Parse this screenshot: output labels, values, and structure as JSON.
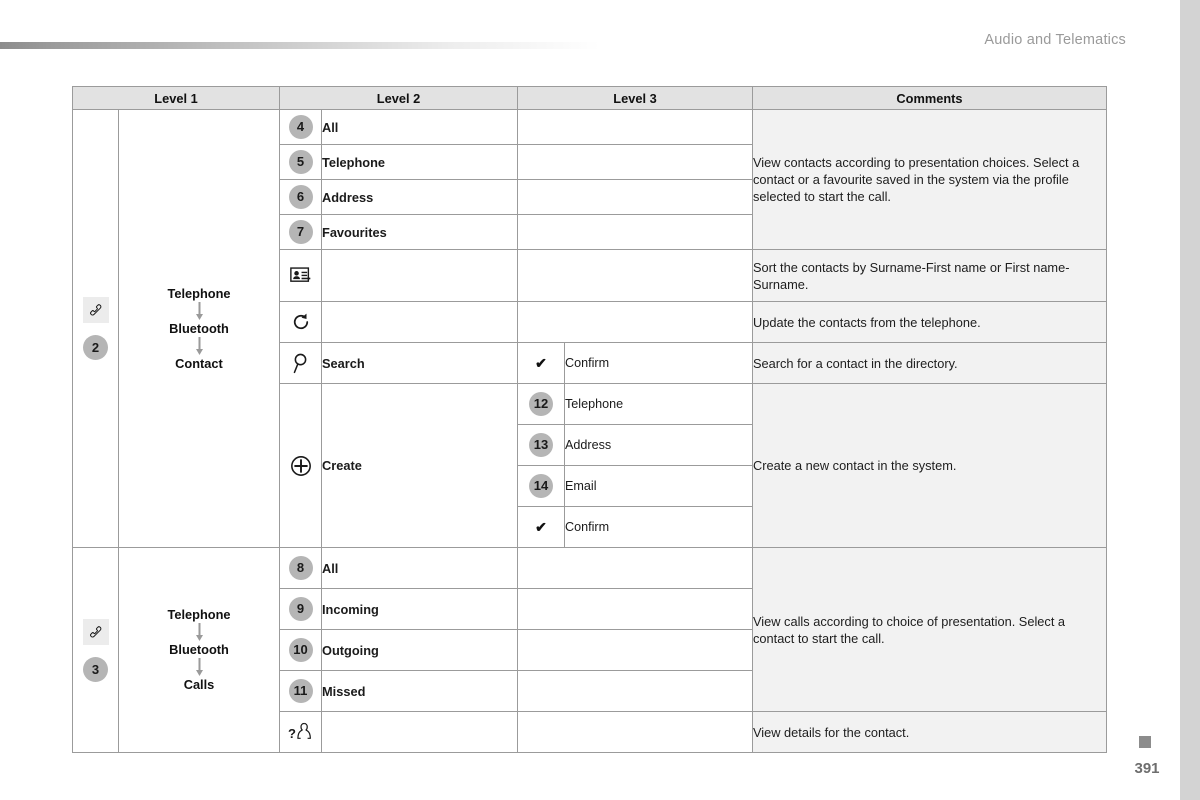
{
  "header": {
    "title": "Audio and Telematics"
  },
  "footer": {
    "page_number": "391",
    "marker_icon": "square-marker-icon"
  },
  "table": {
    "columns": [
      "Level 1",
      "Level 2",
      "Level 3",
      "Comments"
    ],
    "sections": [
      {
        "id_badge": "2",
        "id_icon": "telephone-handset-icon",
        "nav_path": [
          "Telephone",
          "Bluetooth",
          "Contact"
        ],
        "rows": [
          {
            "badge": "4",
            "level2": "All",
            "level3": "",
            "level3_icon": ""
          },
          {
            "badge": "5",
            "level2": "Telephone",
            "level3": "",
            "level3_icon": ""
          },
          {
            "badge": "6",
            "level2": "Address",
            "level3": "",
            "level3_icon": ""
          },
          {
            "badge": "7",
            "level2": "Favourites",
            "level3": "",
            "level3_icon": ""
          },
          {
            "icon": "contact-card-sort-icon",
            "level2": "",
            "level3": "",
            "level3_icon": ""
          },
          {
            "icon": "refresh-circular-arrow-icon",
            "level2": "",
            "level3": "",
            "level3_icon": ""
          },
          {
            "icon": "magnifier-search-icon",
            "level2": "Search",
            "level3": "Confirm",
            "level3_icon": "checkmark-icon"
          },
          {
            "icon": "plus-circle-create-icon",
            "level2": "Create",
            "level3": "Telephone",
            "badge3": "12"
          },
          {
            "level3": "Address",
            "badge3": "13"
          },
          {
            "level3": "Email",
            "badge3": "14"
          },
          {
            "level3": "Confirm",
            "level3_icon": "checkmark-icon"
          }
        ],
        "comments": [
          "View contacts according to presentation choices. Select a contact or a favourite saved in the system via the profile selected to start the call.",
          "Sort the contacts by Surname-First name or First name-Surname.",
          "Update the contacts from the telephone.",
          "Search for a contact in the directory.",
          "Create a new contact in the system."
        ]
      },
      {
        "id_badge": "3",
        "id_icon": "telephone-handset-icon",
        "nav_path": [
          "Telephone",
          "Bluetooth",
          "Calls"
        ],
        "rows": [
          {
            "badge": "8",
            "level2": "All"
          },
          {
            "badge": "9",
            "level2": "Incoming"
          },
          {
            "badge": "10",
            "level2": "Outgoing"
          },
          {
            "badge": "11",
            "level2": "Missed"
          },
          {
            "icon": "person-question-details-icon",
            "level2": ""
          }
        ],
        "comments": [
          "View calls according to choice of presentation. Select a contact to start the call.",
          "View details for the contact."
        ]
      }
    ]
  }
}
